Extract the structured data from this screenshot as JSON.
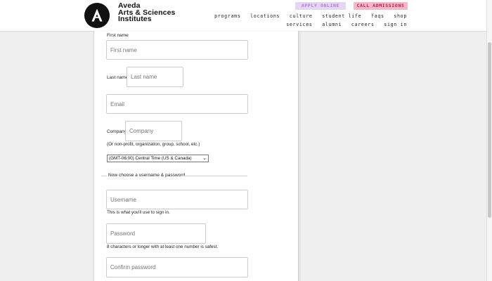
{
  "brand": {
    "line1": "Aveda",
    "line2": "Arts & Sciences",
    "line3": "Institutes"
  },
  "header": {
    "apply_label": "APPLY ONLINE",
    "call_label": "CALL ADMISSIONS",
    "nav_row1": [
      "programs",
      "locations",
      "culture",
      "student life",
      "faqs",
      "shop"
    ],
    "nav_row2": [
      "services",
      "alumni",
      "careers",
      "sign in"
    ]
  },
  "form": {
    "first_name": {
      "label": "First name",
      "placeholder": "First name"
    },
    "last_name": {
      "label": "Last name",
      "placeholder": "Last name"
    },
    "email": {
      "placeholder": "Email"
    },
    "company": {
      "label": "Company",
      "placeholder": "Company",
      "help": "(Or non-profit, organization, group, school, etc.)"
    },
    "timezone": {
      "selected": "(GMT-06:00) Central Time (US & Canada)"
    },
    "account_section_title": "Now choose a username & password",
    "username": {
      "placeholder": "Username",
      "help": "This is what you'll use to sign in."
    },
    "password": {
      "placeholder": "Password",
      "help": "8 characters or longer with at least one number is safest."
    },
    "confirm_password": {
      "placeholder": "Confirm password"
    }
  },
  "colors": {
    "apply_bg": "#e3d7f3",
    "apply_text": "#b07ad8",
    "call_bg": "#f6b7c9",
    "call_text": "#b21f4d"
  },
  "icons": {
    "logo": "aveda-logo-icon",
    "select": "chevron-down-icon"
  }
}
